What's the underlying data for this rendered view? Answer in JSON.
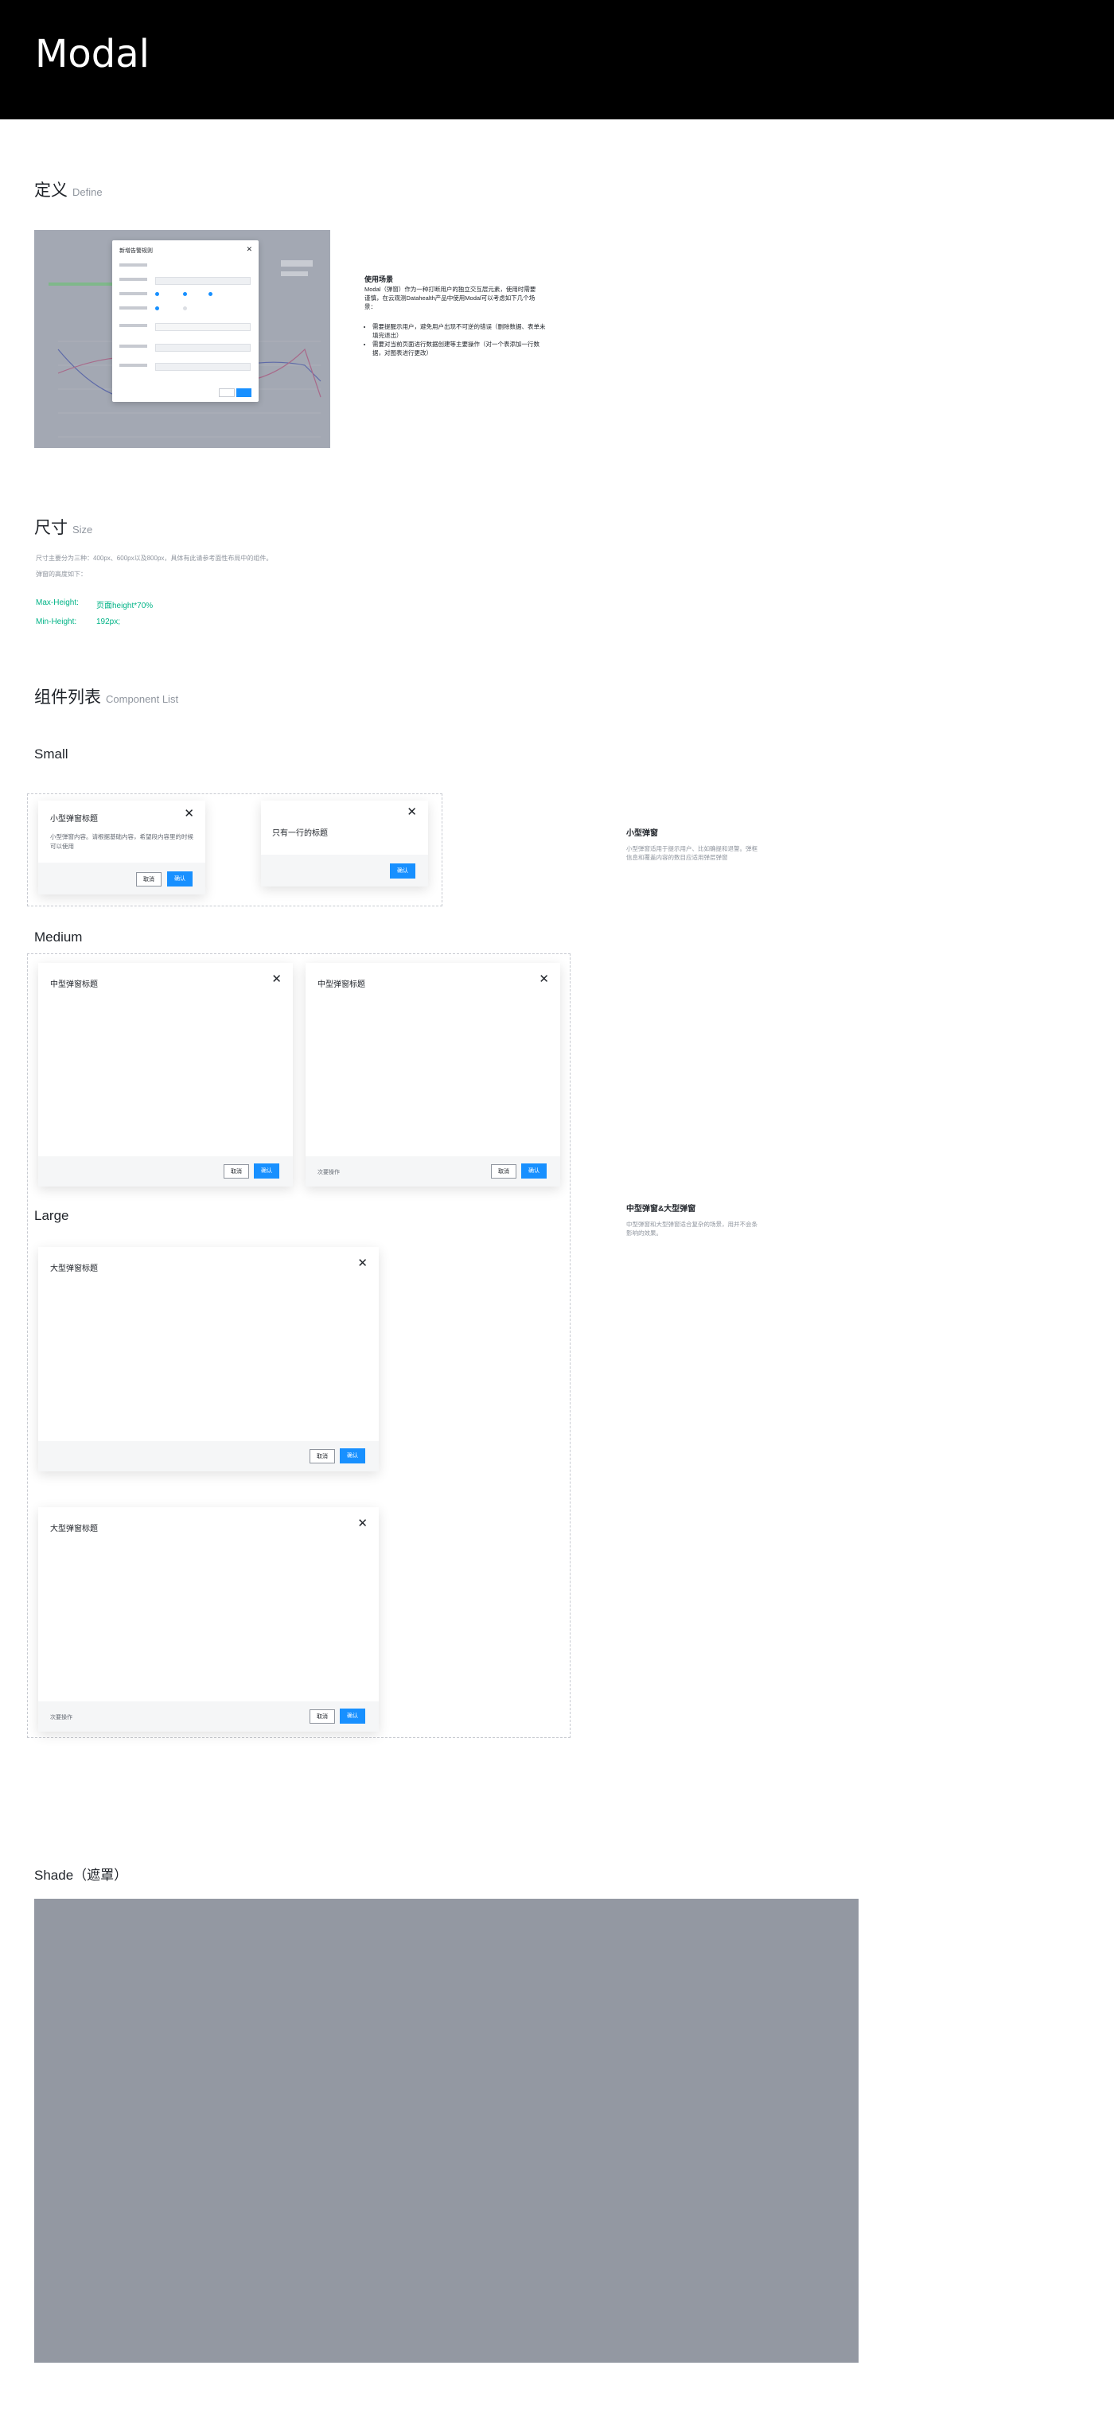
{
  "header": {
    "title": "Modal"
  },
  "define": {
    "title": "定义",
    "title_en": "Define",
    "preview": {
      "modal_title": "新增告警规则"
    },
    "usage_title": "使用场景",
    "usage_desc": "Modal（弹窗）作为一种打断用户的独立交互层元素，使用时需要谨慎，在云观测Datahealth产品中使用Modal可以考虑如下几个场景：",
    "usage_items": [
      "需要提醒示用户，避免用户出现不可逆的错误（删除数据、表单未填完退出）",
      "需要对当前页面进行数据创建等主要操作（对一个表添加一行数据，对图表进行更改）"
    ]
  },
  "size": {
    "title": "尺寸",
    "title_en": "Size",
    "desc1": "尺寸主要分为三种：400px、600px以及800px，具体有此请参考面性布局中的组件。",
    "desc2": "弹窗的高度如下：",
    "max_label": "Max-Height:",
    "max_value": "页面height*70%",
    "min_label": "Min-Height:",
    "min_value": "192px;"
  },
  "components": {
    "title": "组件列表",
    "title_en": "Component List",
    "small_label": "Small",
    "medium_label": "Medium",
    "large_label": "Large",
    "small1": {
      "title": "小型弹窗标题",
      "body": "小型弹窗内容。请根据基础内容，希望段内容里的时候可以使用",
      "cancel": "取消",
      "ok": "确认"
    },
    "small2": {
      "title": "只有一行的标题",
      "ok": "确认"
    },
    "medium1": {
      "title": "中型弹窗标题",
      "cancel": "取消",
      "ok": "确认"
    },
    "medium2": {
      "title": "中型弹窗标题",
      "extra": "次要操作",
      "cancel": "取消",
      "ok": "确认"
    },
    "large1": {
      "title": "大型弹窗标题",
      "cancel": "取消",
      "ok": "确认"
    },
    "large2": {
      "title": "大型弹窗标题",
      "extra": "次要操作",
      "cancel": "取消",
      "ok": "确认"
    },
    "small_side": {
      "title": "小型弹窗",
      "desc": "小型弹窗适用于提示用户、比如确提和退警。弹框信息和覆盖内容的数目应适用弹层弹窗"
    },
    "ml_side": {
      "title": "中型弹窗&大型弹窗",
      "desc": "中型弹窗和大型弹窗适合复杂的场景，用并不会条影响的效果。"
    }
  },
  "shade": {
    "title": "Shade（遮罩）"
  }
}
